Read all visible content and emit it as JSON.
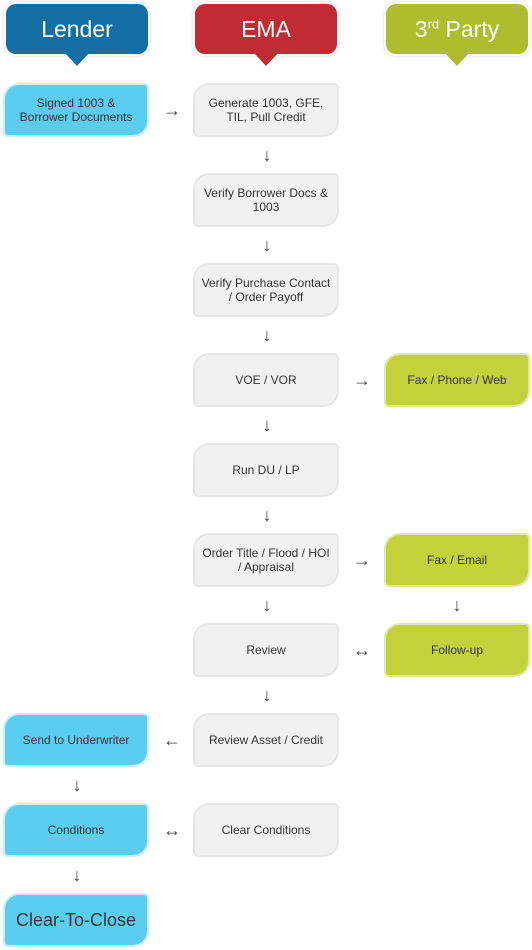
{
  "headers": {
    "lender": {
      "label": "Lender",
      "color": "#136ea3"
    },
    "ema": {
      "label": "EMA",
      "color": "#c22b33"
    },
    "third_party": {
      "label": "3",
      "sup": "rd",
      "label_rest": " Party",
      "color": "#aebd2e"
    }
  },
  "nodes": {
    "signed": "Signed 1003 & Borrower Documents",
    "generate": "Generate 1003, GFE, TIL, Pull Credit",
    "verify_docs": "Verify Borrower Docs & 1003",
    "verify_purchase": "Verify Purchase Contact / Order Payoff",
    "voe": "VOE / VOR",
    "fax_phone": "Fax / Phone / Web",
    "run_du": "Run DU / LP",
    "order_title": "Order Title / Flood / HOI / Appraisal",
    "fax_email": "Fax / Email",
    "review": "Review",
    "followup": "Follow-up",
    "review_asset": "Review Asset / Credit",
    "send_uw": "Send to Underwriter",
    "conditions": "Conditions",
    "clear_conditions": "Clear Conditions",
    "ctc": "Clear-To-Close"
  },
  "arrows": {
    "right": "→",
    "down": "↓",
    "left": "←",
    "both": "↔"
  },
  "colors": {
    "lender_box": "#5bcdf0",
    "ema_box": "#f1f1f1",
    "third_box": "#c3d13a"
  }
}
